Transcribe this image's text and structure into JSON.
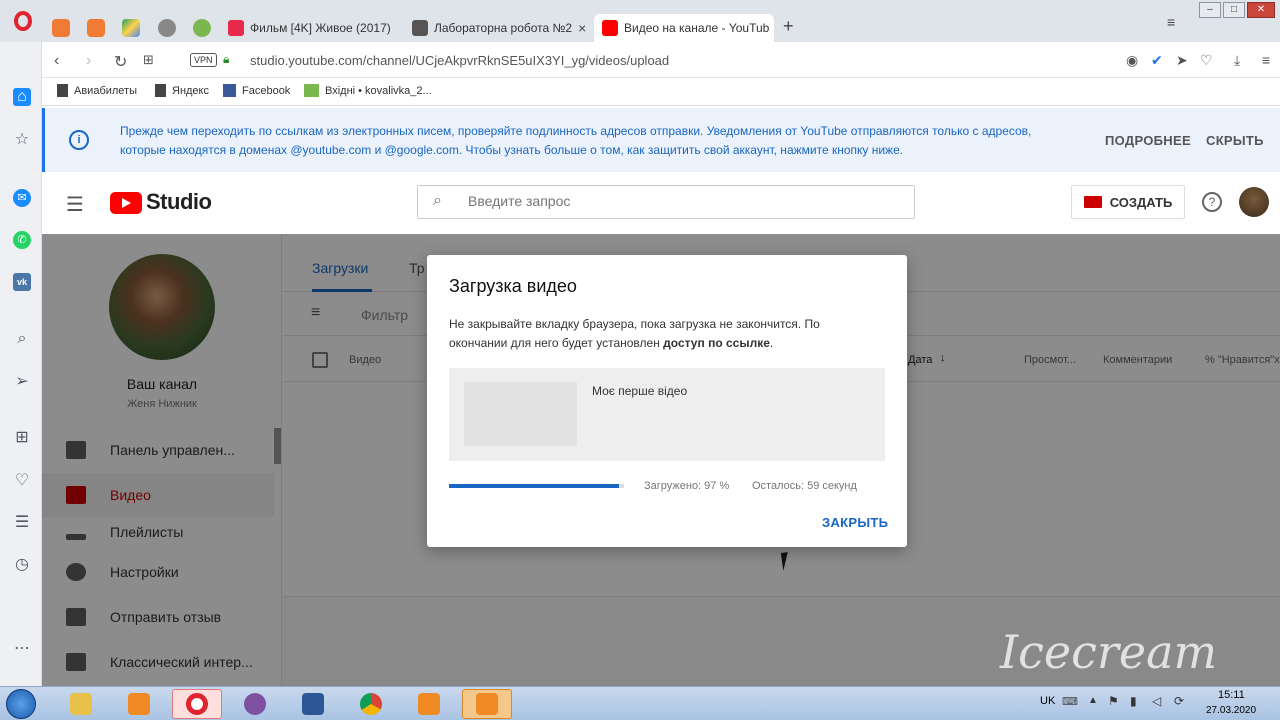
{
  "browser": {
    "tabs": [
      {
        "label": "Фильм [4K] Живое (2017)",
        "favicon_color": "#e8294c"
      },
      {
        "label": "Лабораторна робота №2",
        "favicon_color": "#555555"
      },
      {
        "label": "Видео на канале - YouTub",
        "favicon_color": "#ff0000",
        "active": true
      }
    ],
    "new_tab": "+",
    "url": "studio.youtube.com/channel/UCjeAkpvrRknSE5uIX3YI_yg/videos/upload",
    "vpn_label": "VPN",
    "bookmarks": [
      {
        "label": "Авиабилеты"
      },
      {
        "label": "Яндекс"
      },
      {
        "label": "Facebook"
      },
      {
        "label": "Вхідні • kovalivka_2..."
      }
    ]
  },
  "banner": {
    "text": "Прежде чем переходить по ссылкам из электронных писем, проверяйте подлинность адресов отправки. Уведомления от YouTube отправляются только с адресов, которые находятся в доменах @youtube.com и @google.com. Чтобы узнать больше о том, как защитить свой аккаунт, нажмите кнопку ниже.",
    "more": "ПОДРОБНЕЕ",
    "hide": "СКРЫТЬ"
  },
  "studio": {
    "logo_text": "Studio",
    "search_placeholder": "Введите запрос",
    "create_label": "СОЗДАТЬ"
  },
  "channel": {
    "title": "Ваш канал",
    "name": "Женя Нижник"
  },
  "nav": [
    {
      "label": "Панель управлен..."
    },
    {
      "label": "Видео",
      "active": true
    },
    {
      "label": "Плейлисты"
    },
    {
      "label": "Настройки"
    },
    {
      "label": "Отправить отзыв"
    },
    {
      "label": "Классический интер..."
    }
  ],
  "content": {
    "tab_uploads": "Загрузки",
    "tab_partial": "Тр",
    "filter": "Фильтр",
    "col_video": "Видео",
    "col_date": "Дата",
    "col_views": "Просмот...",
    "col_comments": "Комментарии",
    "col_likes": "% \"Нравится\"х"
  },
  "dialog": {
    "title": "Загрузка видео",
    "message_pre": "Не закрывайте вкладку браузера, пока загрузка не закончится. По окончании для него будет установлен ",
    "message_bold": "доступ по ссылке",
    "message_post": ".",
    "video_name": "Моє перше відео",
    "progress_percent": 97,
    "uploaded_text": "Загружено: 97 %",
    "remaining_text": "Осталось: 59 секунд",
    "close_label": "ЗАКРЫТЬ"
  },
  "taskbar": {
    "lang": "UK",
    "time": "15:11",
    "date": "27.03.2020"
  },
  "watermark": {
    "text": "Icecream"
  },
  "colors": {
    "accent": "#1a66c4",
    "youtube_red": "#ff0000",
    "active_nav": "#cc0000"
  }
}
